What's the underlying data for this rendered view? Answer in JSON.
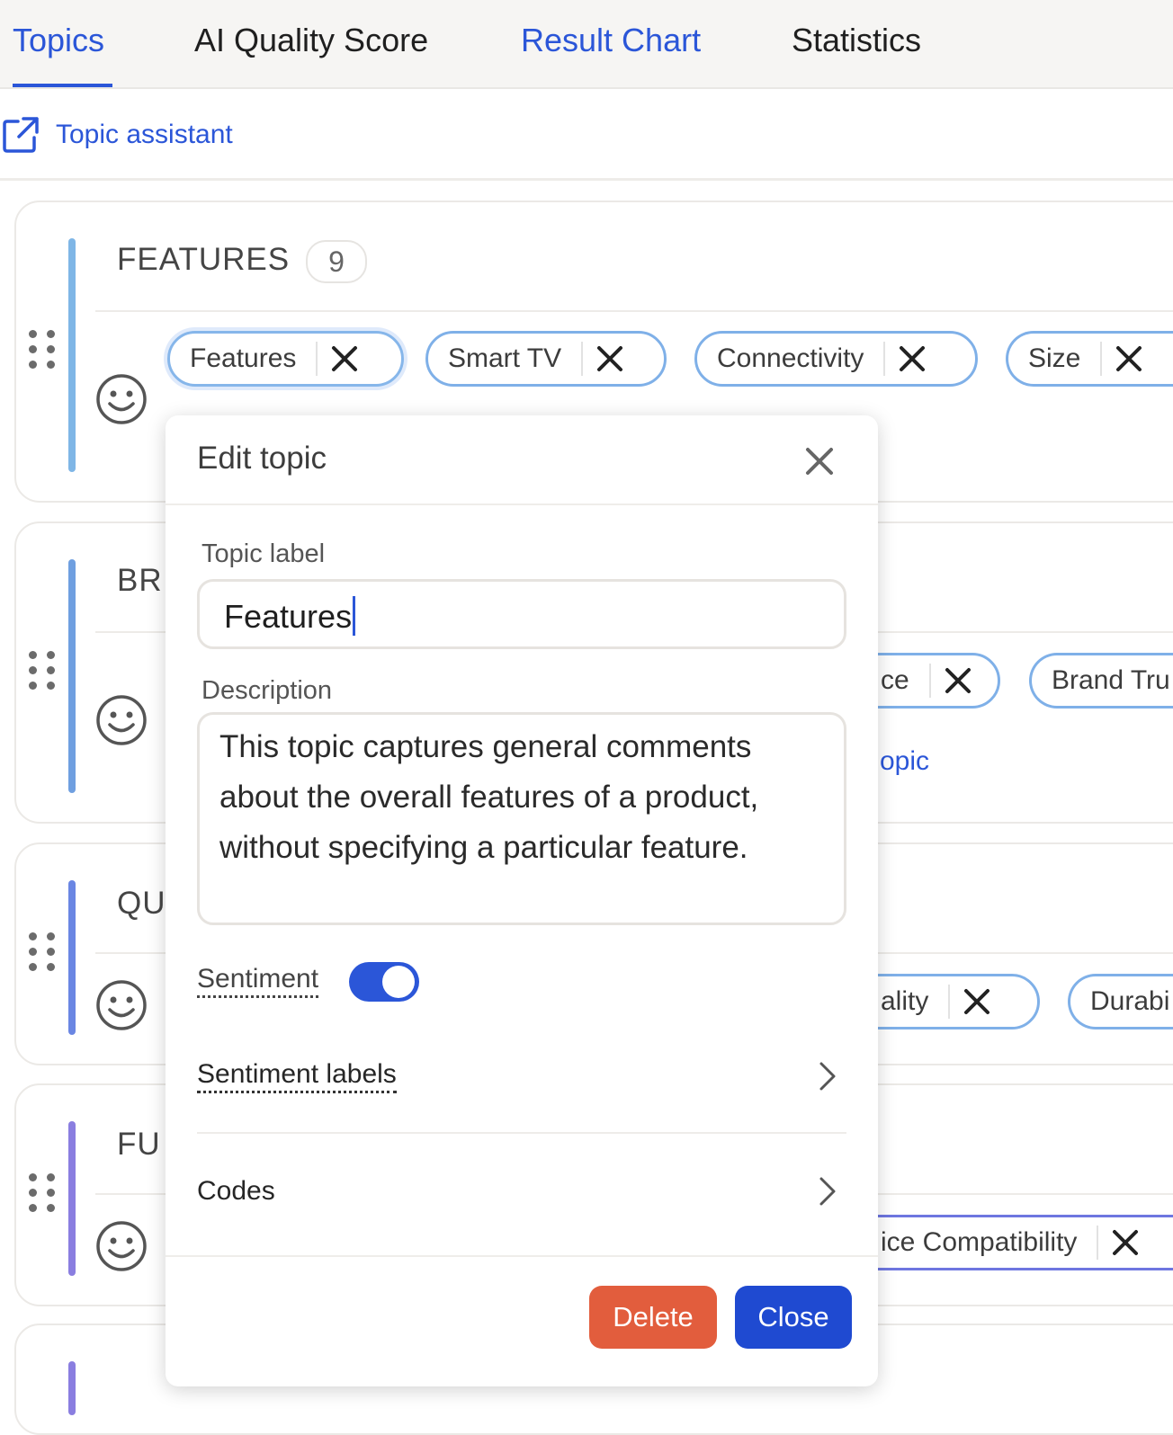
{
  "tabs": [
    {
      "label": "Topics",
      "active": true
    },
    {
      "label": "AI Quality Score",
      "active": false
    },
    {
      "label": "Result Chart",
      "active": false
    },
    {
      "label": "Statistics",
      "active": false
    }
  ],
  "assistant": {
    "label": "Topic assistant",
    "icon": "external-link-icon"
  },
  "groups": [
    {
      "title": "FEATURES",
      "count": "9",
      "accent": "#7fb6e6",
      "chips": [
        "Features",
        "Smart TV",
        "Connectivity",
        "Size"
      ]
    },
    {
      "title": "BR",
      "accent": "#6f9fe0",
      "chips": [
        "ce",
        "Brand Tru"
      ],
      "link": "opic"
    },
    {
      "title": "QU",
      "accent": "#6a86e3",
      "chips": [
        "ality",
        "Durabi"
      ]
    },
    {
      "title": "FU",
      "accent": "#8a7ee0",
      "chips": [
        "ice Compatibility"
      ]
    }
  ],
  "modal": {
    "title": "Edit topic",
    "topic_label_caption": "Topic label",
    "topic_label_value": "Features",
    "description_caption": "Description",
    "description_value": "This topic captures general comments about the overall features of a product, without specifying a particular feature.",
    "sentiment_label": "Sentiment",
    "sentiment_on": true,
    "sentiment_labels": "Sentiment labels",
    "codes": "Codes",
    "delete_label": "Delete",
    "close_label": "Close"
  },
  "colors": {
    "primary": "#2b56d8",
    "danger": "#e25d3d",
    "chip_border": "#7fb0e8"
  }
}
